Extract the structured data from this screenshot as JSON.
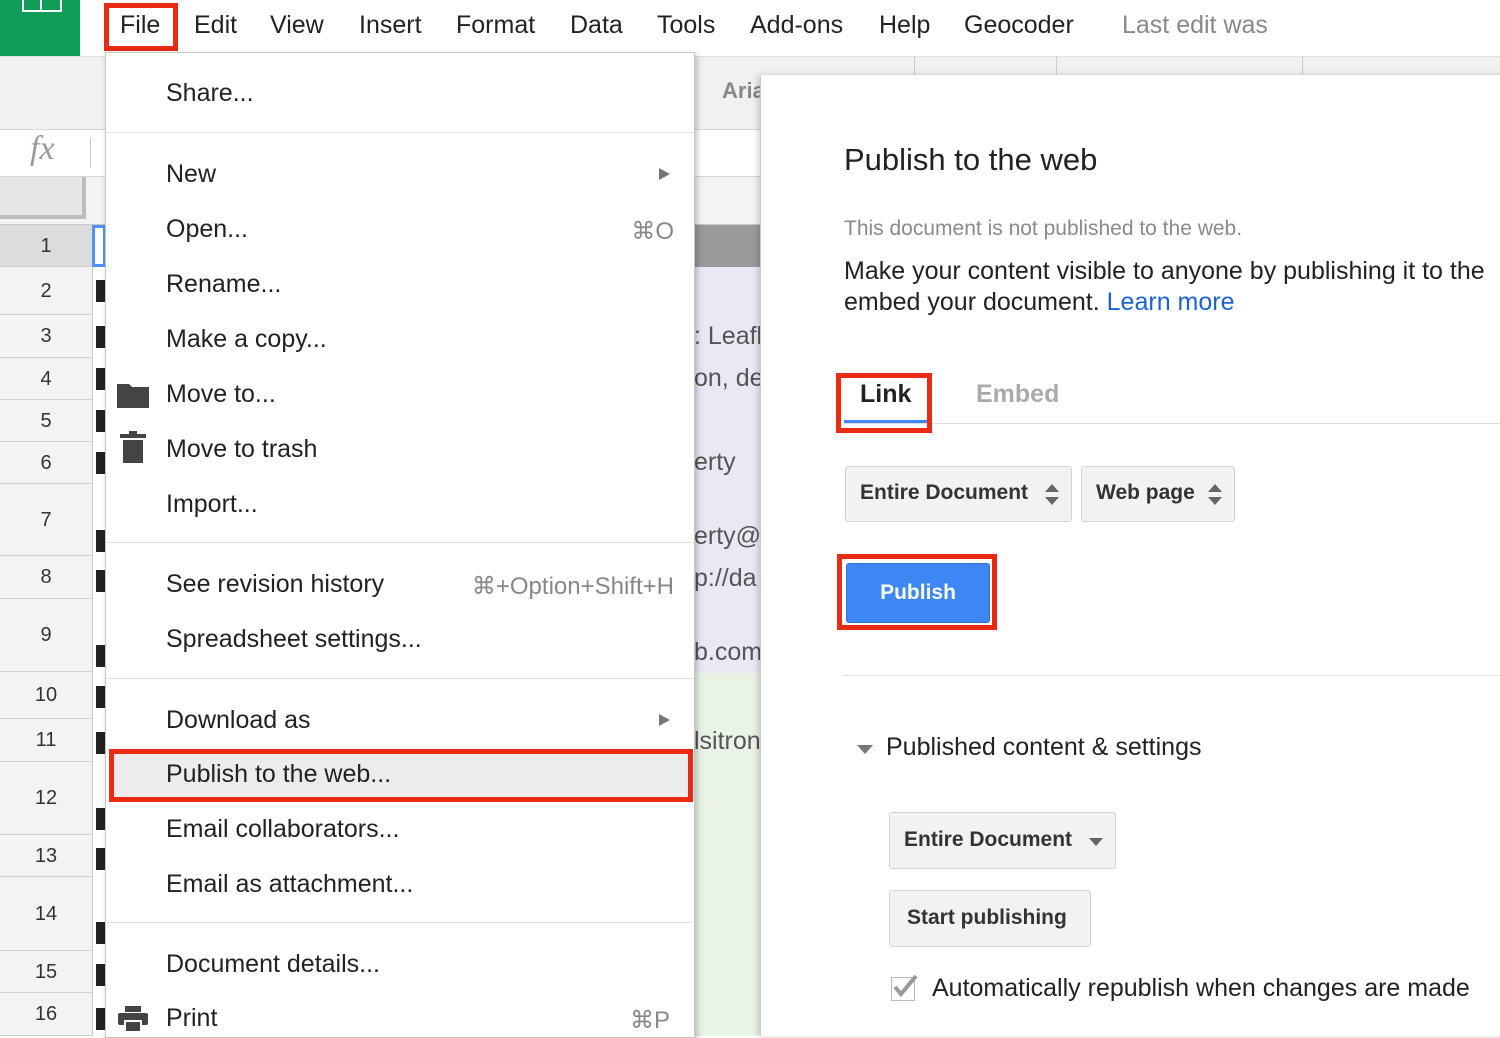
{
  "menubar": {
    "items": [
      "File",
      "Edit",
      "View",
      "Insert",
      "Format",
      "Data",
      "Tools",
      "Add-ons",
      "Help",
      "Geocoder"
    ],
    "last_edit": "Last edit was"
  },
  "toolbar": {
    "font_name": "Aria"
  },
  "grid": {
    "rows": [
      "1",
      "2",
      "3",
      "4",
      "5",
      "6",
      "7",
      "8",
      "9",
      "10",
      "11",
      "12",
      "13",
      "14",
      "15",
      "16"
    ],
    "peek_text": [
      ": Leafle",
      "on, de",
      "erty",
      "erty@t",
      "p://da",
      "b.com",
      "lsitron"
    ]
  },
  "file_menu": {
    "share": "Share...",
    "new": "New",
    "open": "Open...",
    "open_shortcut": "⌘O",
    "rename": "Rename...",
    "make_copy": "Make a copy...",
    "move_to": "Move to...",
    "move_to_trash": "Move to trash",
    "import": "Import...",
    "revision_history": "See revision history",
    "revision_shortcut": "⌘+Option+Shift+H",
    "spreadsheet_settings": "Spreadsheet settings...",
    "download_as": "Download as",
    "publish_to_web": "Publish to the web...",
    "email_collaborators": "Email collaborators...",
    "email_attachment": "Email as attachment...",
    "document_details": "Document details...",
    "print": "Print",
    "print_shortcut": "⌘P"
  },
  "publish_dialog": {
    "title": "Publish to the web",
    "status": "This document is not published to the web.",
    "description_line1": "Make your content visible to anyone by publishing it to the",
    "description_line2": "embed your document.",
    "learn_more": "Learn more",
    "tab_link": "Link",
    "tab_embed": "Embed",
    "scope_select": "Entire Document",
    "format_select": "Web page",
    "publish_button": "Publish",
    "settings_heading": "Published content & settings",
    "settings_scope_select": "Entire Document",
    "start_publishing": "Start publishing",
    "auto_republish_label": "Automatically republish when changes are made",
    "auto_republish_checked": true
  },
  "colors": {
    "highlight": "#ea2a12",
    "primary_button": "#3d86f5",
    "link": "#1a62d6",
    "sheets_green": "#0f9d58"
  }
}
